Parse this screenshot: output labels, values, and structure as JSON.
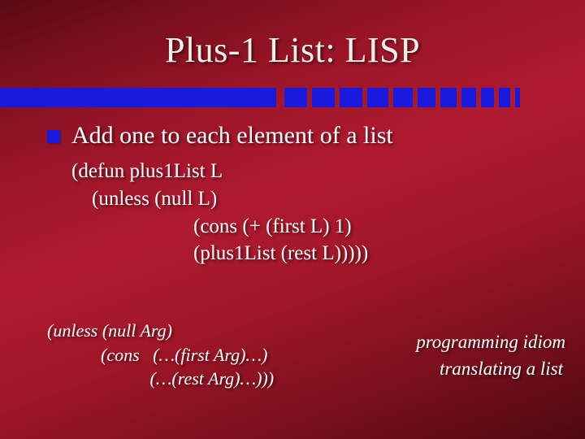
{
  "title": "Plus-1 List:  LISP",
  "bullet": "Add one to each element of a list",
  "code_lines": [
    "(defun plus1List L",
    "    (unless (null L)",
    "                        (cons (+ (first L) 1)",
    "                        (plus1List (rest L)))))"
  ],
  "idiom_code_lines": [
    "(unless (null Arg)",
    "            (cons   (…(first Arg)…)",
    "                       (…(rest Arg)…)))"
  ],
  "idiom_label_lines": [
    "programming idiom",
    "     translating a list"
  ],
  "tick_widths": [
    28,
    28,
    28,
    26,
    24,
    22,
    20,
    18,
    16,
    14,
    6
  ],
  "colors": {
    "accent": "#1a1adf"
  }
}
